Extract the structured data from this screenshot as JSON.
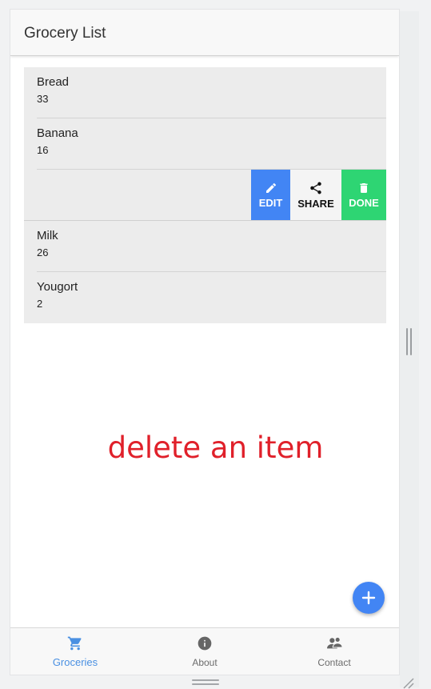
{
  "header": {
    "title": "Grocery List"
  },
  "groceries": [
    {
      "name": "Bread",
      "qty": "33"
    },
    {
      "name": "Banana",
      "qty": "16"
    },
    {
      "name": "Milk",
      "qty": "26"
    },
    {
      "name": "Yougort",
      "qty": "2"
    }
  ],
  "swipe_actions": {
    "edit": "EDIT",
    "share": "SHARE",
    "done": "DONE"
  },
  "overlay_text": "delete an item",
  "fab": {
    "icon": "plus-icon"
  },
  "tabs": [
    {
      "label": "Groceries",
      "icon": "cart-icon",
      "active": true
    },
    {
      "label": "About",
      "icon": "info-icon",
      "active": false
    },
    {
      "label": "Contact",
      "icon": "contacts-icon",
      "active": false
    }
  ],
  "colors": {
    "primary": "#4285f4",
    "done": "#2ed573",
    "overlay": "#e0202a",
    "active_tab": "#4a90e2",
    "inactive_icon": "#6b6b6b"
  }
}
